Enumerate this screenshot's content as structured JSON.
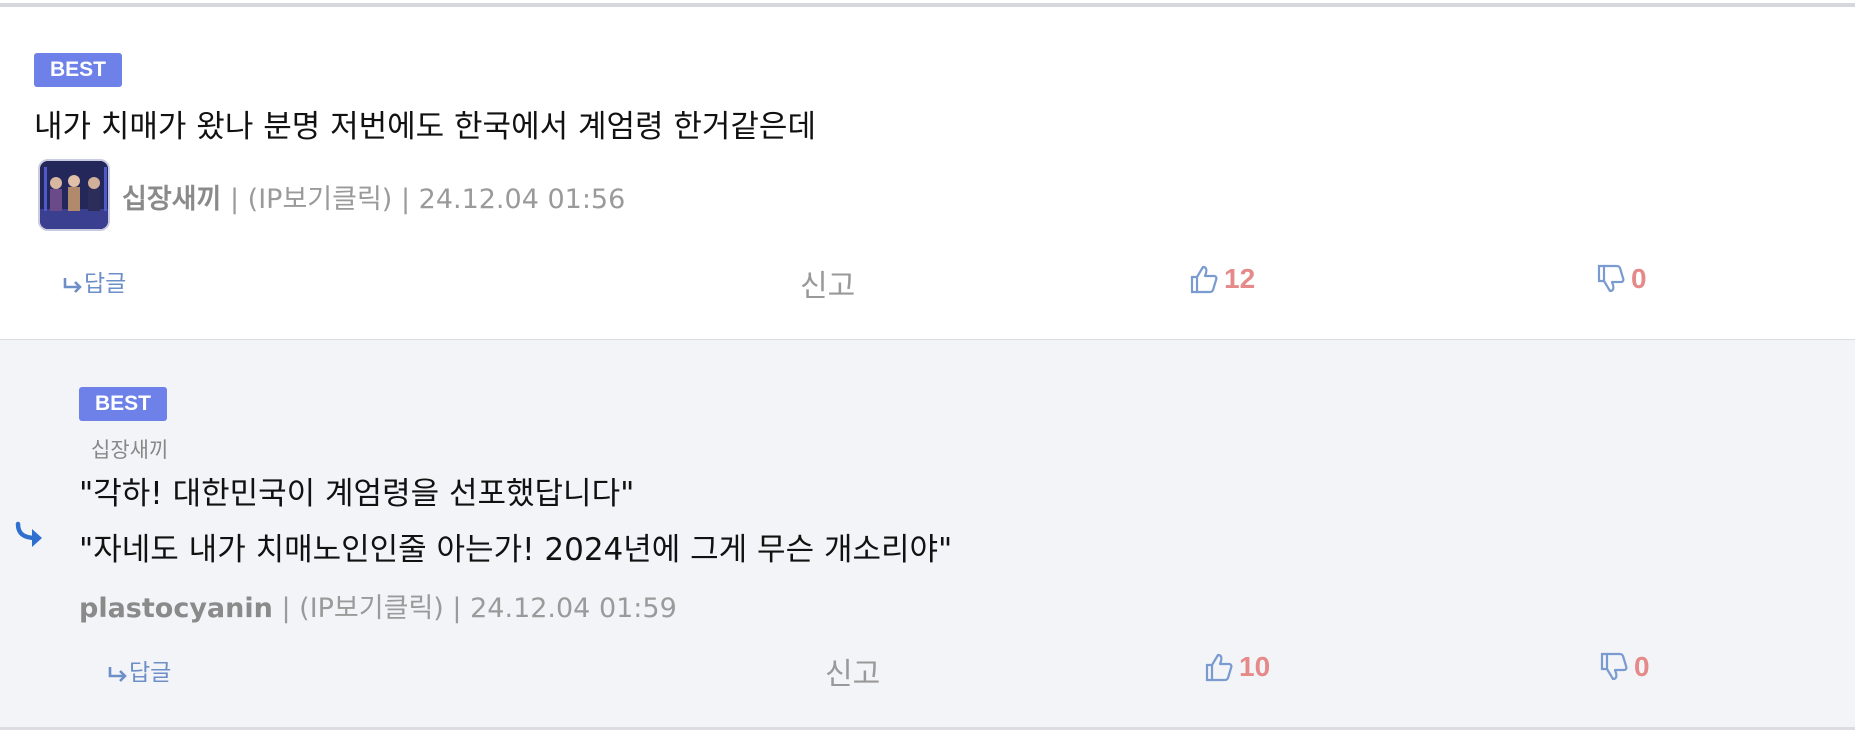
{
  "colors": {
    "badge": "#6d81e8",
    "vote_count": "#e58989",
    "icon_blue": "#7a9bd0",
    "reply_arrow": "#2f6fd0",
    "reply_bg": "#f3f4f7"
  },
  "comments": [
    {
      "badge": "BEST",
      "text": "내가 치매가 왔나 분명 저번에도 한국에서 계엄령 한거같은데",
      "author": "십장새끼",
      "ip_label": "(IP보기클릭)",
      "sep": "|",
      "timestamp": "24.12.04 01:56",
      "reply_label": "답글",
      "report_label": "신고",
      "upvotes": "12",
      "downvotes": "0",
      "avatar_icon": "avatar-image"
    },
    {
      "badge": "BEST",
      "reply_to": "십장새끼",
      "lines": [
        "\"각하! 대한민국이 계엄령을 선포했답니다\"",
        "\"자네도 내가 치매노인인줄 아는가! 2024년에 그게 무슨 개소리야\""
      ],
      "author": "plastocyanin",
      "ip_label": "(IP보기클릭)",
      "sep": "|",
      "timestamp": "24.12.04 01:59",
      "reply_label": "답글",
      "report_label": "신고",
      "upvotes": "10",
      "downvotes": "0",
      "reply_icon": "reply-arrow-icon"
    }
  ]
}
